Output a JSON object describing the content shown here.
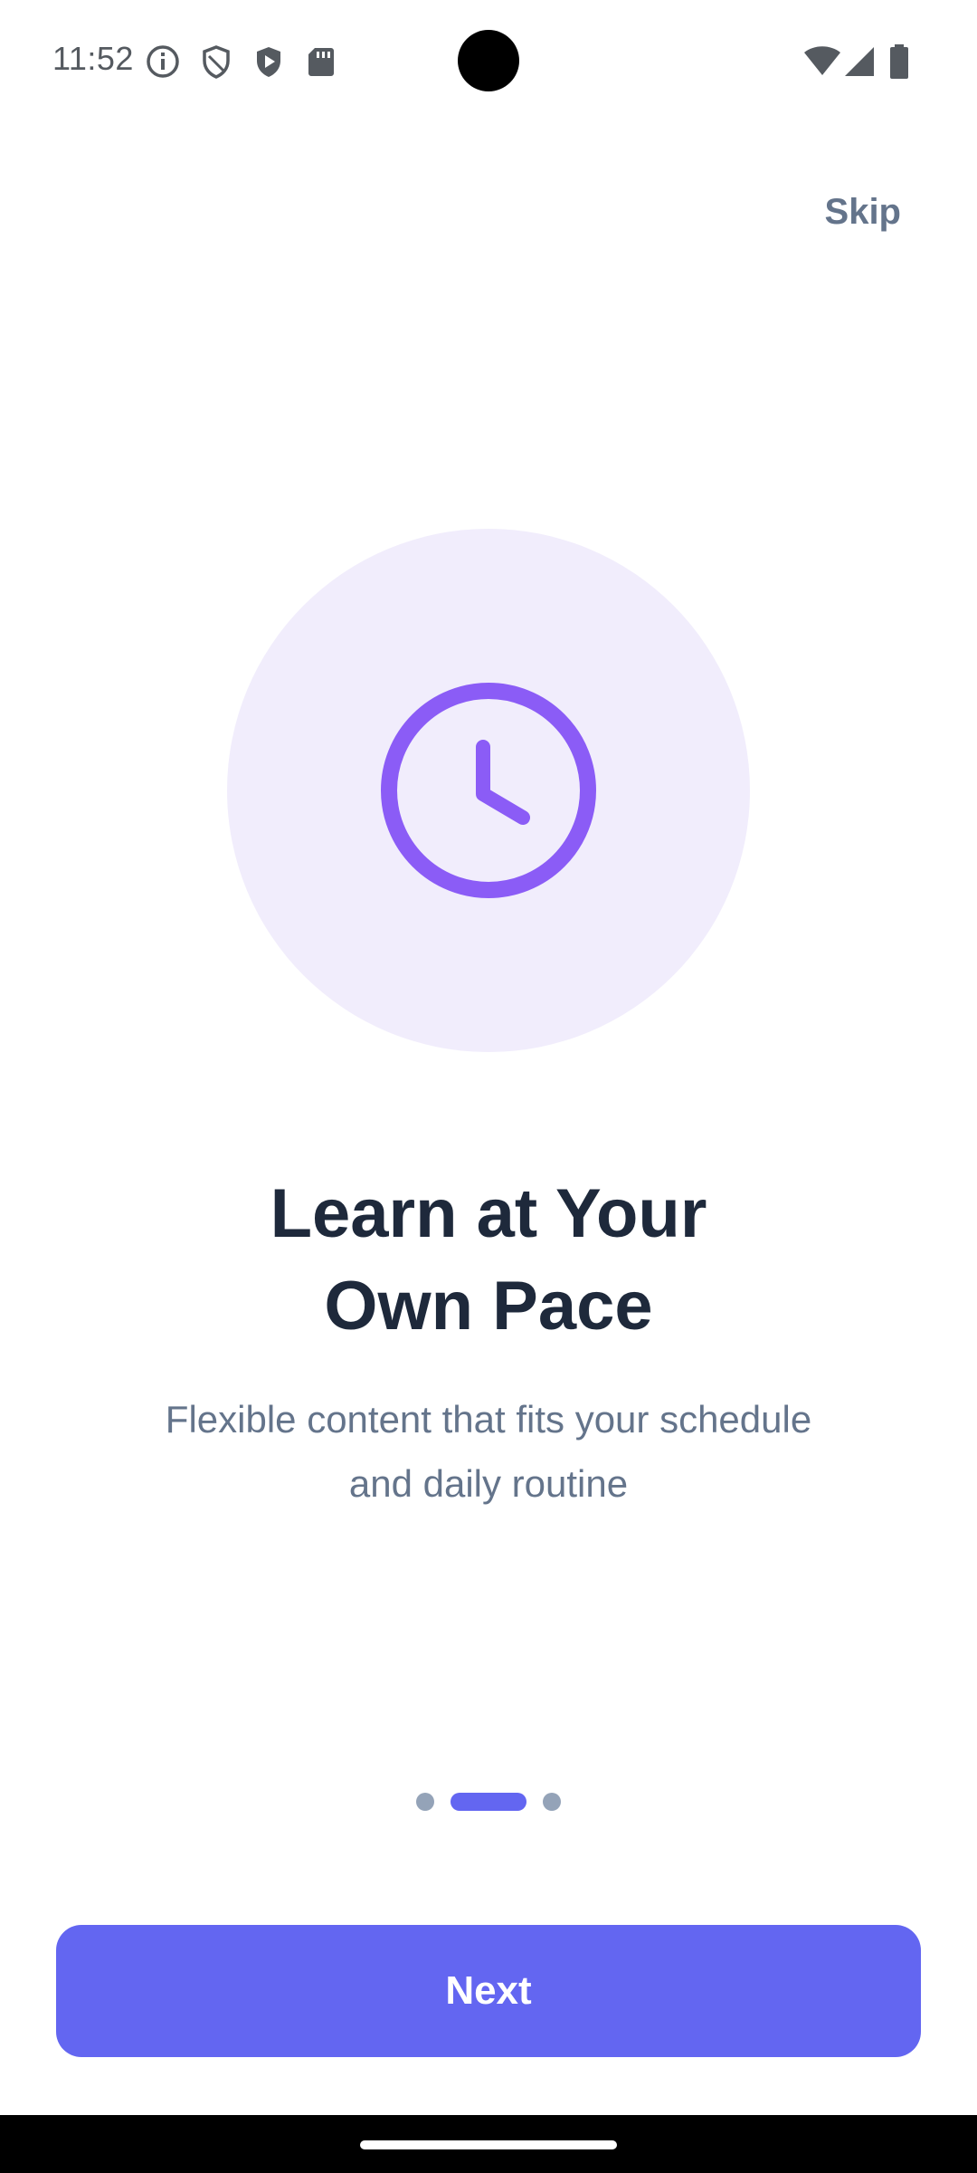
{
  "status_bar": {
    "time": "11:52",
    "left_icons": [
      "info-icon",
      "shield-outline-icon",
      "play-shield-icon",
      "sd-card-icon"
    ],
    "right_icons": [
      "wifi-icon",
      "signal-icon",
      "battery-icon"
    ]
  },
  "header": {
    "skip_label": "Skip"
  },
  "illustration": {
    "icon": "clock-icon",
    "accent_color": "#8b5cf6",
    "background_color": "#f1edfc"
  },
  "content": {
    "title_line1": "Learn at Your",
    "title_line2": "Own Pace",
    "subtitle_line1": "Flexible content that fits your schedule",
    "subtitle_line2": "and daily routine"
  },
  "pager": {
    "page_count": 3,
    "active_index": 1
  },
  "footer": {
    "next_label": "Next",
    "primary_color": "#6366f1"
  }
}
